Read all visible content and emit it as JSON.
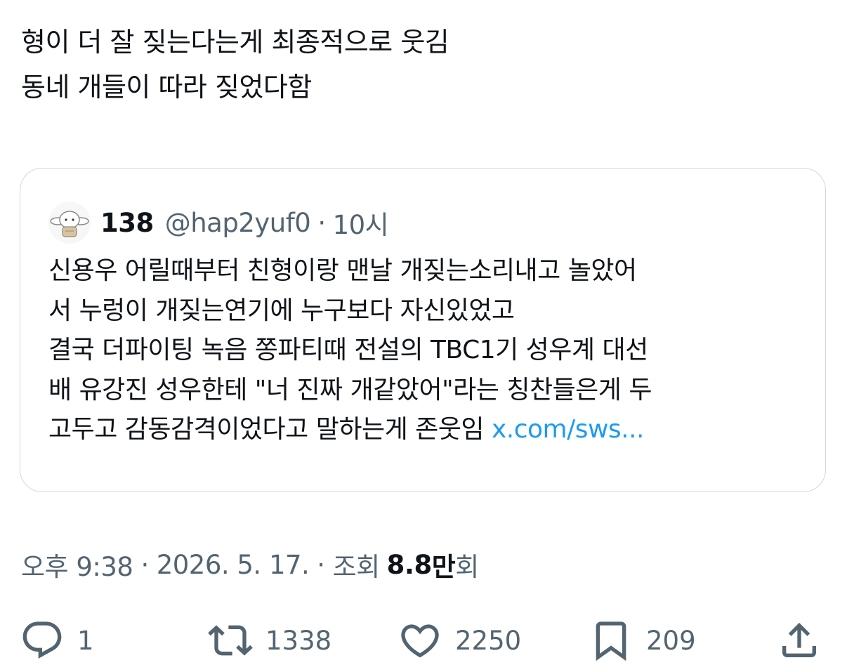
{
  "tweet": {
    "lines": [
      "형이 더 잘 짖는다는게 최종적으로 웃김",
      "동네 개들이 따라 짖었다함"
    ]
  },
  "quote": {
    "name": "138",
    "handle": "@hap2yuf0",
    "dot": "·",
    "time": "10시",
    "lines": [
      "신용우 어릴때부터 친형이랑 맨날 개짖는소리내고 놀았어",
      "서 누렁이 개짖는연기에 누구보다 자신있었고",
      "결국 더파이팅 녹음 쫑파티때 전설의 TBC1기 성우계 대선",
      "배 유강진 성우한테 \"너 진짜 개같았어\"라는 칭찬들은게 두"
    ],
    "last_line_text": "고두고 감동감격이었다고 말하는게 존웃임",
    "link": "x.com/sws..."
  },
  "meta": {
    "time": "오후 9:38",
    "sep": "·",
    "date": "2026. 5. 17.",
    "views_label": "조회",
    "views_value": "8.8",
    "views_unit": "만",
    "views_suffix": "회"
  },
  "actions": {
    "replies": "1",
    "retweets": "1338",
    "likes": "2250",
    "bookmarks": "209"
  },
  "colors": {
    "text": "#0f1419",
    "secondary": "#536471",
    "link": "#1d9bf0",
    "border": "#cfd9de"
  },
  "icons": [
    "reply-icon",
    "retweet-icon",
    "like-icon",
    "bookmark-icon",
    "share-icon"
  ]
}
